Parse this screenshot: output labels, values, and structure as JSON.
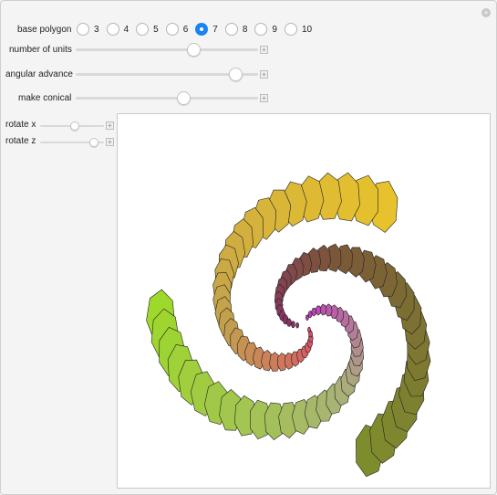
{
  "controls": {
    "base_polygon": {
      "label": "base polygon",
      "options": [
        "3",
        "4",
        "5",
        "6",
        "7",
        "8",
        "9",
        "10"
      ],
      "selected": "7"
    },
    "number_of_units": {
      "label": "number of units",
      "value": 0.66
    },
    "angular_advance": {
      "label": "angular advance",
      "value": 0.91
    },
    "make_conical": {
      "label": "make conical",
      "value": 0.6
    },
    "rotate_x": {
      "label": "rotate x",
      "value": 0.55
    },
    "rotate_z": {
      "label": "rotate z",
      "value": 0.9
    }
  },
  "plot": {
    "arms": 3,
    "palette": {
      "outer": [
        "#9dd82a",
        "#e7c22c",
        "#7e8d2c"
      ],
      "middle": [
        "#a9b07a",
        "#c1a04e",
        "#7b5838"
      ],
      "inner": [
        "#c233c0",
        "#e0466c",
        "#8a2b6e"
      ]
    }
  }
}
